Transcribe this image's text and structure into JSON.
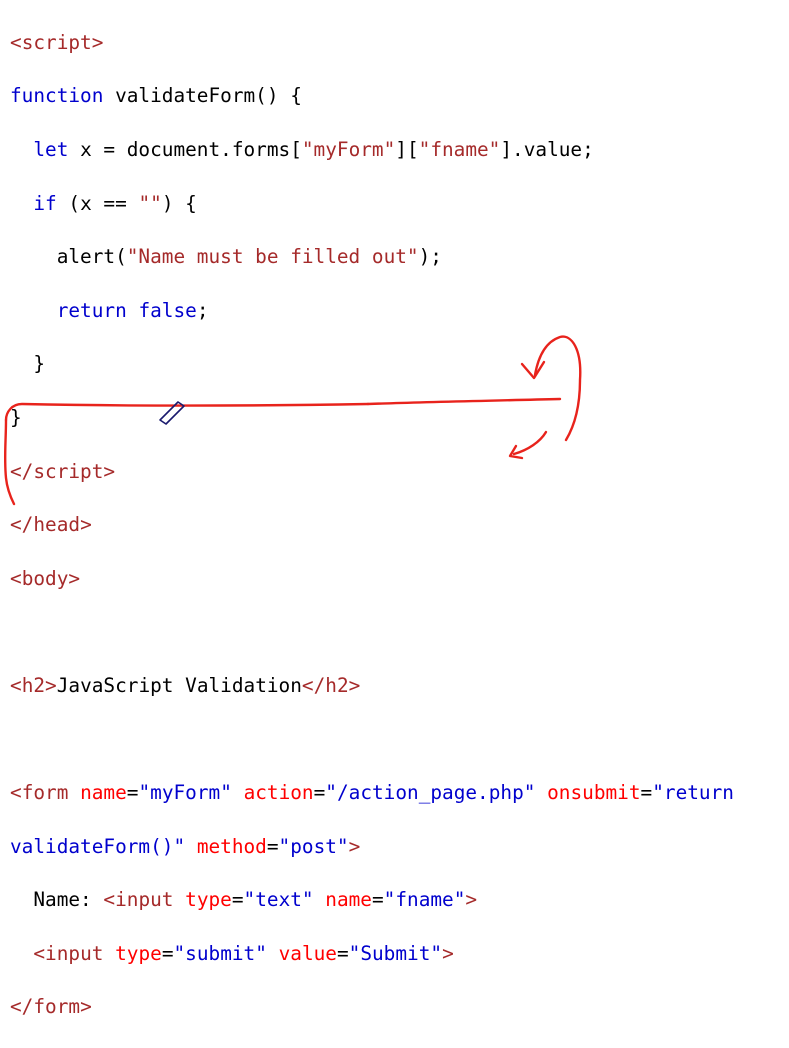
{
  "code": {
    "language": "html",
    "lines": {
      "l1": {
        "open": "<",
        "tag": "script",
        "close": ">"
      },
      "l2": {
        "kw": "function",
        "rest": " validateForm() {"
      },
      "l3": {
        "indent": "  ",
        "kw": "let",
        "pre": " x = document.forms[",
        "s1": "\"myForm\"",
        "mid": "][",
        "s2": "\"fname\"",
        "post": "].value;"
      },
      "l4": {
        "indent": "  ",
        "kw": "if",
        "pre": " (x == ",
        "s1": "\"\"",
        "post": ") {"
      },
      "l5": {
        "indent": "    ",
        "pre": "alert(",
        "s1": "\"Name must be filled out\"",
        "post": ");"
      },
      "l6": {
        "indent": "    ",
        "kw": "return",
        "sp": " ",
        "kw2": "false",
        "post": ";"
      },
      "l7": {
        "text": "  }"
      },
      "l8": {
        "text": "}"
      },
      "l9": {
        "open": "</",
        "tag": "script",
        "close": ">"
      },
      "l10": {
        "open": "</",
        "tag": "head",
        "close": ">"
      },
      "l11": {
        "open": "<",
        "tag": "body",
        "close": ">"
      },
      "l12": {
        "text": ""
      },
      "l13": {
        "open": "<",
        "tag": "h2",
        "close": ">",
        "content": "JavaScript Validation",
        "open2": "</",
        "tag2": "h2",
        "close2": ">"
      },
      "l14": {
        "text": ""
      },
      "l15": {
        "open": "<",
        "tag": "form",
        "a1": "name",
        "v1": "\"myForm\"",
        "a2": "action",
        "v2": "\"/action_page.php\"",
        "a3": "onsubmit",
        "v3": "\"return"
      },
      "l16": {
        "v3b": "validateForm()\"",
        "a4": "method",
        "v4": "\"post\"",
        "close": ">"
      },
      "l17": {
        "indent": "  ",
        "label": "Name: ",
        "open": "<",
        "tag": "input",
        "a1": "type",
        "v1": "\"text\"",
        "a2": "name",
        "v2": "\"fname\"",
        "close": ">"
      },
      "l18": {
        "indent": "  ",
        "open": "<",
        "tag": "input",
        "a1": "type",
        "v1": "\"submit\"",
        "a2": "value",
        "v2": "\"Submit\"",
        "close": ">"
      },
      "l19": {
        "open": "</",
        "tag": "form",
        "close": ">"
      }
    }
  },
  "colors": {
    "tag": "#a52a2a",
    "attribute": "#ff0000",
    "attribute_value": "#0000cd",
    "keyword": "#0000cd",
    "string": "#a52a2a",
    "annotation": "#e8231c"
  },
  "annotations": [
    "arrow-from-onsubmit-to-action",
    "arrow-to-fname-input",
    "bracket-left-of-form",
    "underline-action-page"
  ]
}
